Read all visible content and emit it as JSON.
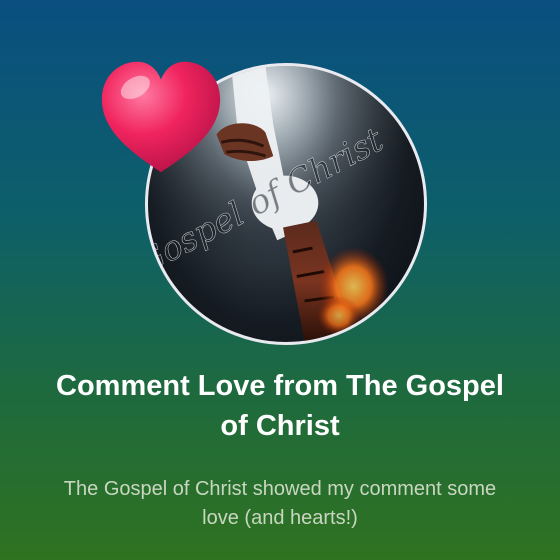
{
  "card": {
    "title": "Comment Love from The Gospel of Christ",
    "subtitle": "The Gospel of Christ showed my comment some love (and hearts!)"
  },
  "avatar": {
    "watermark_text": "Gospel of Christ"
  },
  "icons": {
    "heart": "heart-icon"
  },
  "colors": {
    "heart": "#f0245e",
    "title": "#ffffff",
    "subtitle": "#c9d6c0"
  }
}
